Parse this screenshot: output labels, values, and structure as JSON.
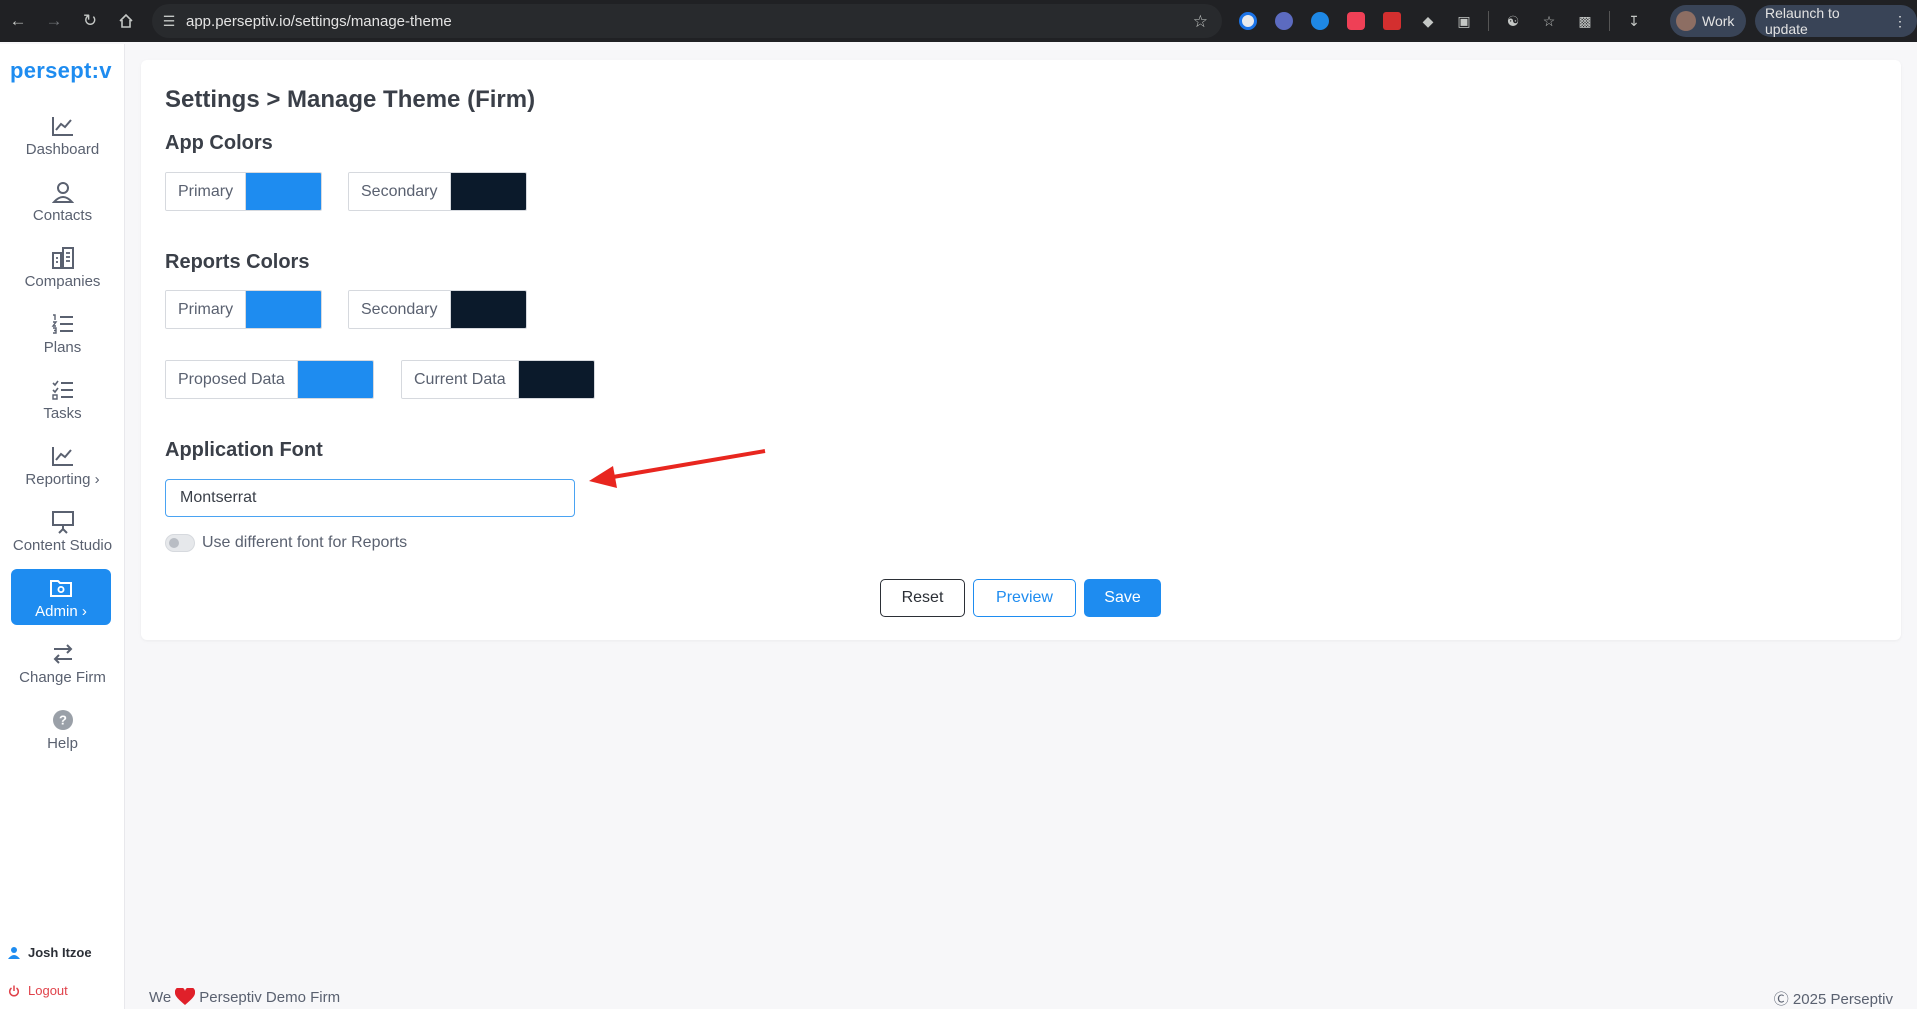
{
  "browser": {
    "url": "app.perseptiv.io/settings/manage-theme",
    "profile_label": "Work",
    "relaunch_label": "Relaunch to update"
  },
  "sidebar": {
    "logo": "persept:v",
    "items": [
      {
        "label": "Dashboard",
        "icon": "line-chart-icon"
      },
      {
        "label": "Contacts",
        "icon": "person-icon"
      },
      {
        "label": "Companies",
        "icon": "building-icon"
      },
      {
        "label": "Plans",
        "icon": "numbered-list-icon"
      },
      {
        "label": "Tasks",
        "icon": "checklist-icon"
      },
      {
        "label": "Reporting",
        "icon": "line-chart-icon"
      },
      {
        "label": "Content Studio",
        "icon": "presentation-icon"
      },
      {
        "label": "Admin",
        "icon": "admin-folder-icon"
      },
      {
        "label": "Change Firm",
        "icon": "swap-arrows-icon"
      },
      {
        "label": "Help",
        "icon": "help-icon"
      }
    ],
    "user_name": "Josh Itzoe",
    "logout_label": "Logout"
  },
  "main": {
    "title": "Settings > Manage Theme (Firm)",
    "app_colors": {
      "heading": "App Colors",
      "primary_label": "Primary",
      "secondary_label": "Secondary"
    },
    "reports_colors": {
      "heading": "Reports Colors",
      "primary_label": "Primary",
      "secondary_label": "Secondary",
      "proposed_label": "Proposed Data",
      "current_label": "Current Data"
    },
    "font": {
      "heading": "Application Font",
      "value": "Montserrat",
      "toggle_label": "Use different font for Reports",
      "toggle_on": false
    },
    "buttons": {
      "reset": "Reset",
      "preview": "Preview",
      "save": "Save"
    }
  },
  "colors": {
    "primary": "#1e8cf0",
    "secondary": "#0b1a2b"
  },
  "footer": {
    "left_prefix": "We",
    "left_suffix": "Perseptiv Demo Firm",
    "right": "Ⓒ 2025 Perseptiv"
  }
}
